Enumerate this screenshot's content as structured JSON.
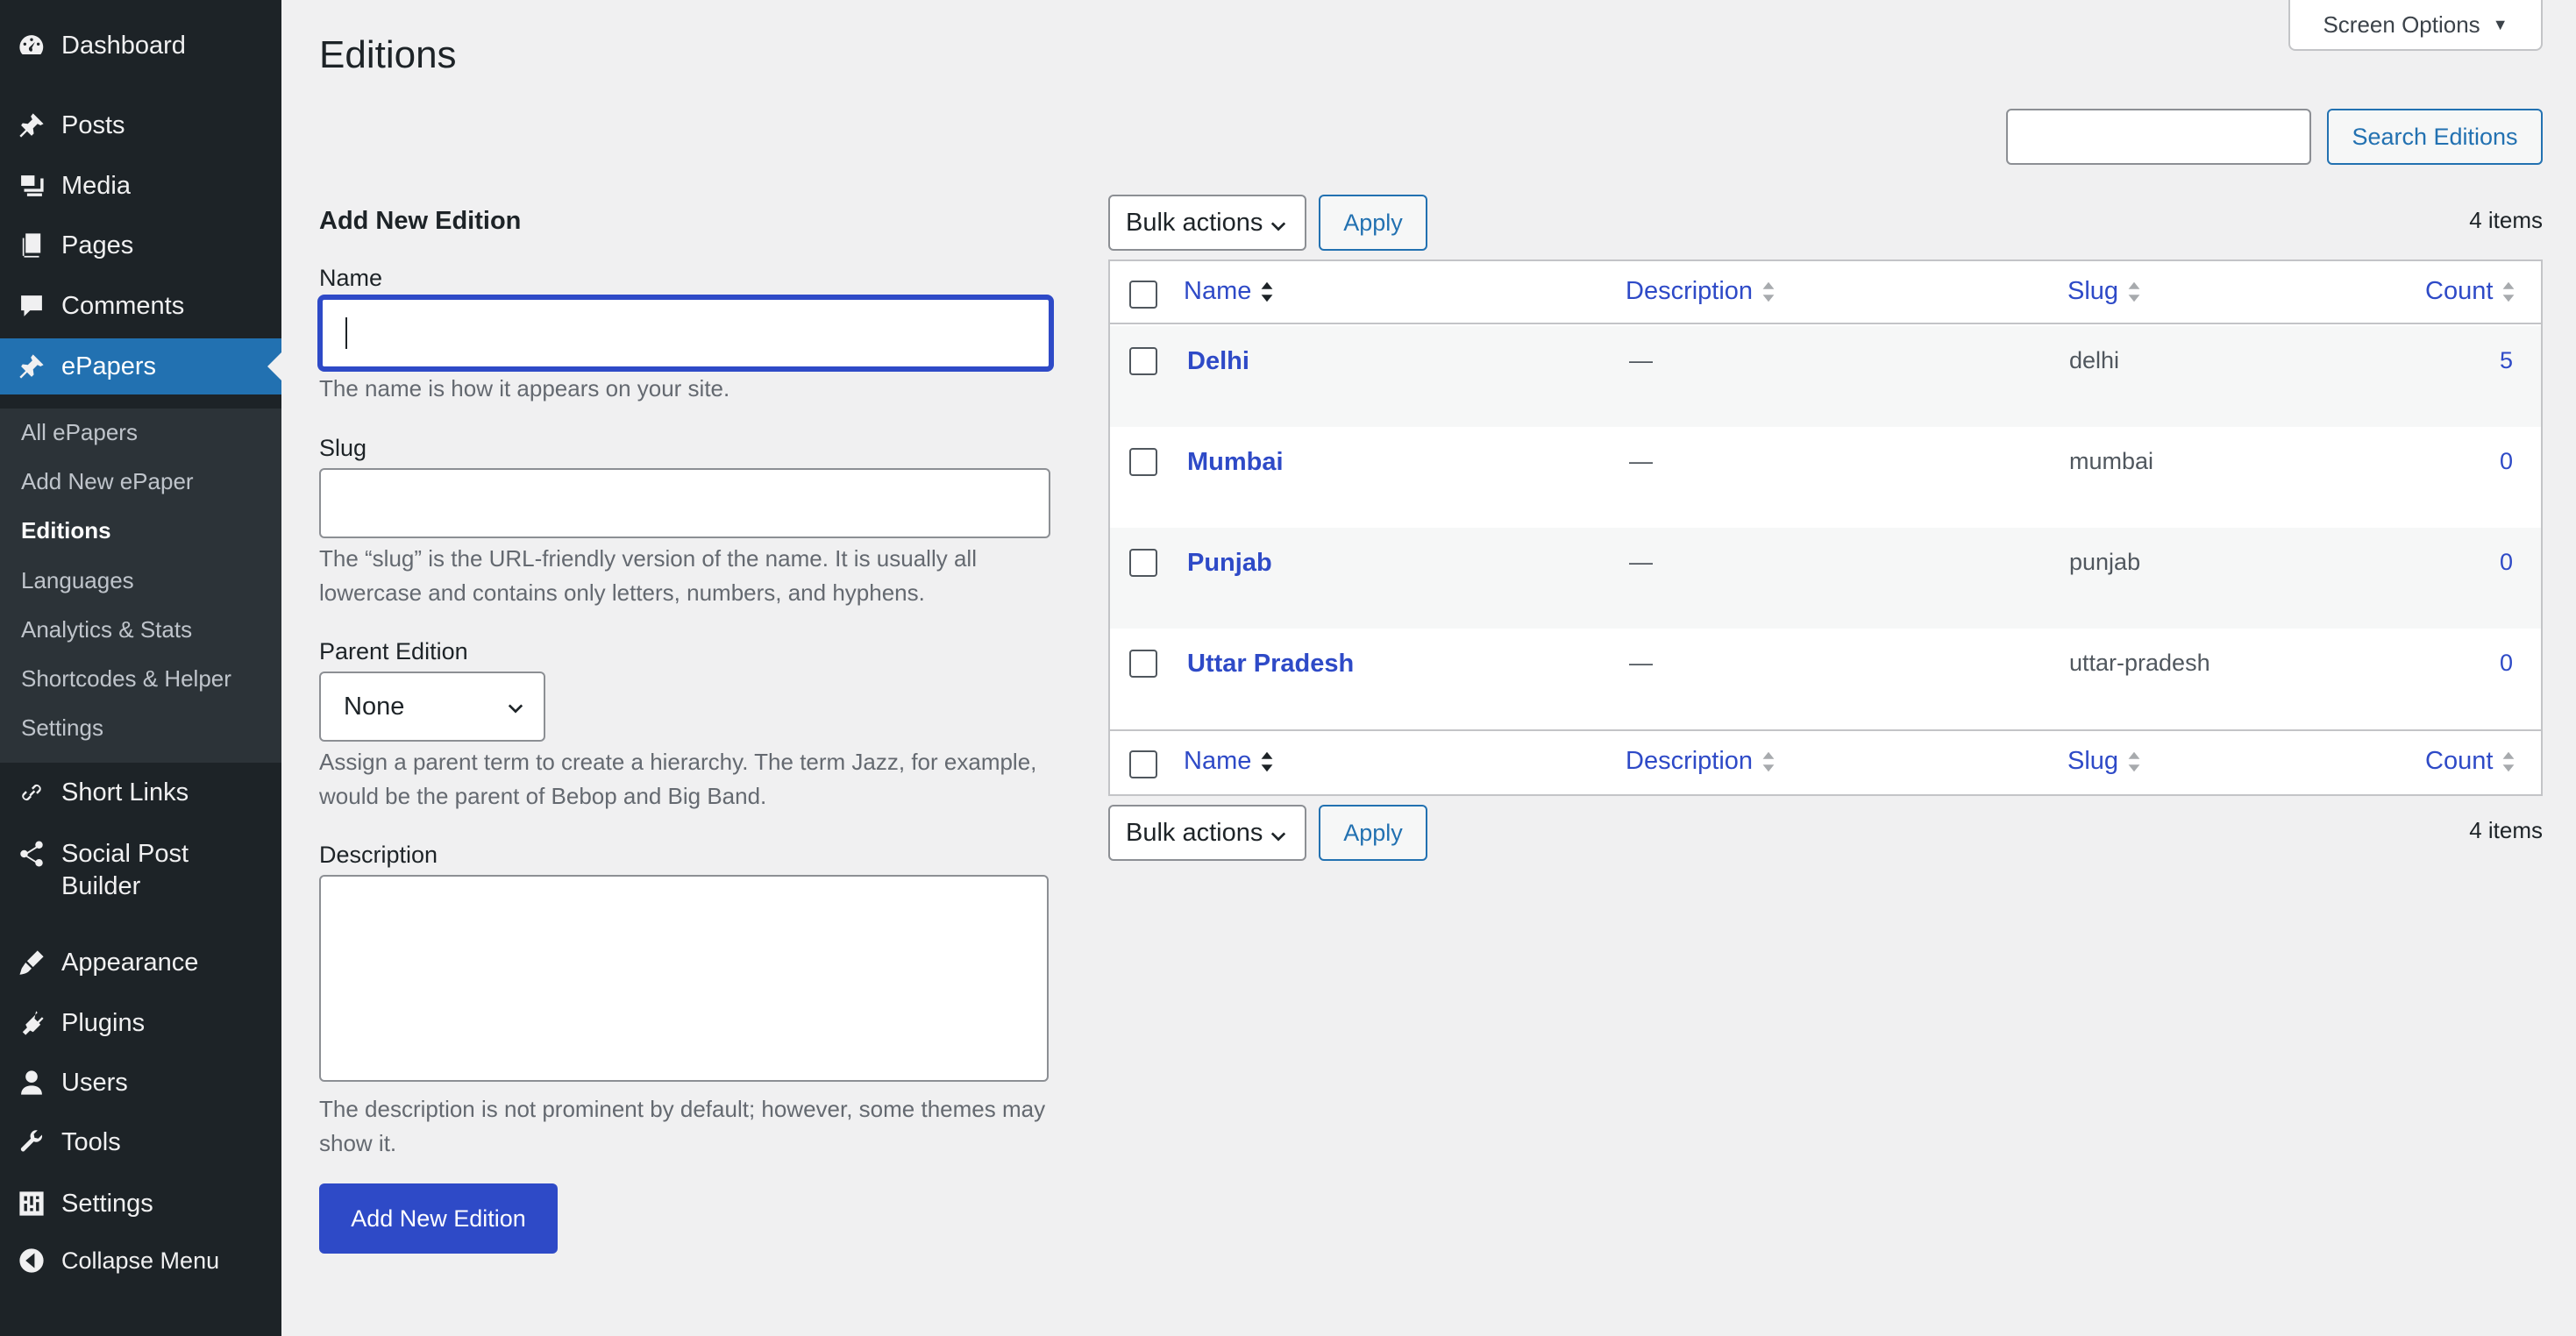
{
  "sidebar": {
    "items": [
      {
        "label": "Dashboard",
        "icon": "dashboard-icon"
      },
      {
        "label": "Posts",
        "icon": "pin-icon"
      },
      {
        "label": "Media",
        "icon": "media-icon"
      },
      {
        "label": "Pages",
        "icon": "pages-icon"
      },
      {
        "label": "Comments",
        "icon": "comment-icon"
      },
      {
        "label": "ePapers",
        "icon": "pin-icon"
      },
      {
        "label": "Short Links",
        "icon": "link-icon"
      },
      {
        "label": "Social Post",
        "label2": "Builder",
        "icon": "share-icon"
      },
      {
        "label": "Appearance",
        "icon": "brush-icon"
      },
      {
        "label": "Plugins",
        "icon": "plugin-icon"
      },
      {
        "label": "Users",
        "icon": "user-icon"
      },
      {
        "label": "Tools",
        "icon": "wrench-icon"
      },
      {
        "label": "Settings",
        "icon": "settings-icon"
      },
      {
        "label": "Collapse Menu",
        "icon": "collapse-icon"
      }
    ],
    "submenu": [
      "All ePapers",
      "Add New ePaper",
      "Editions",
      "Languages",
      "Analytics & Stats",
      "Shortcodes & Helper",
      "Settings"
    ],
    "active_color": "#2271b1"
  },
  "page": {
    "title": "Editions",
    "screen_options": "Screen Options",
    "search_button": "Search Editions",
    "search_value": ""
  },
  "form": {
    "heading": "Add New Edition",
    "name_label": "Name",
    "name_value": "",
    "name_hint": "The name is how it appears on your site.",
    "slug_label": "Slug",
    "slug_value": "",
    "slug_hint": "The “slug” is the URL-friendly version of the name. It is usually all lowercase and contains only letters, numbers, and hyphens.",
    "parent_label": "Parent Edition",
    "parent_selected": "None",
    "parent_hint": "Assign a parent term to create a hierarchy. The term Jazz, for example, would be the parent of Bebop and Big Band.",
    "description_label": "Description",
    "description_value": "",
    "description_hint": "The description is not prominent by default; however, some themes may show it.",
    "submit": "Add New Edition",
    "primary_color": "#2e4ac7"
  },
  "table": {
    "bulk_actions": "Bulk actions",
    "apply": "Apply",
    "items_count": "4 items",
    "columns": {
      "name": "Name",
      "description": "Description",
      "slug": "Slug",
      "count": "Count"
    },
    "rows": [
      {
        "name": "Delhi",
        "description": "—",
        "slug": "delhi",
        "count": "5"
      },
      {
        "name": "Mumbai",
        "description": "—",
        "slug": "mumbai",
        "count": "0"
      },
      {
        "name": "Punjab",
        "description": "—",
        "slug": "punjab",
        "count": "0"
      },
      {
        "name": "Uttar Pradesh",
        "description": "—",
        "slug": "uttar-pradesh",
        "count": "0"
      }
    ]
  }
}
